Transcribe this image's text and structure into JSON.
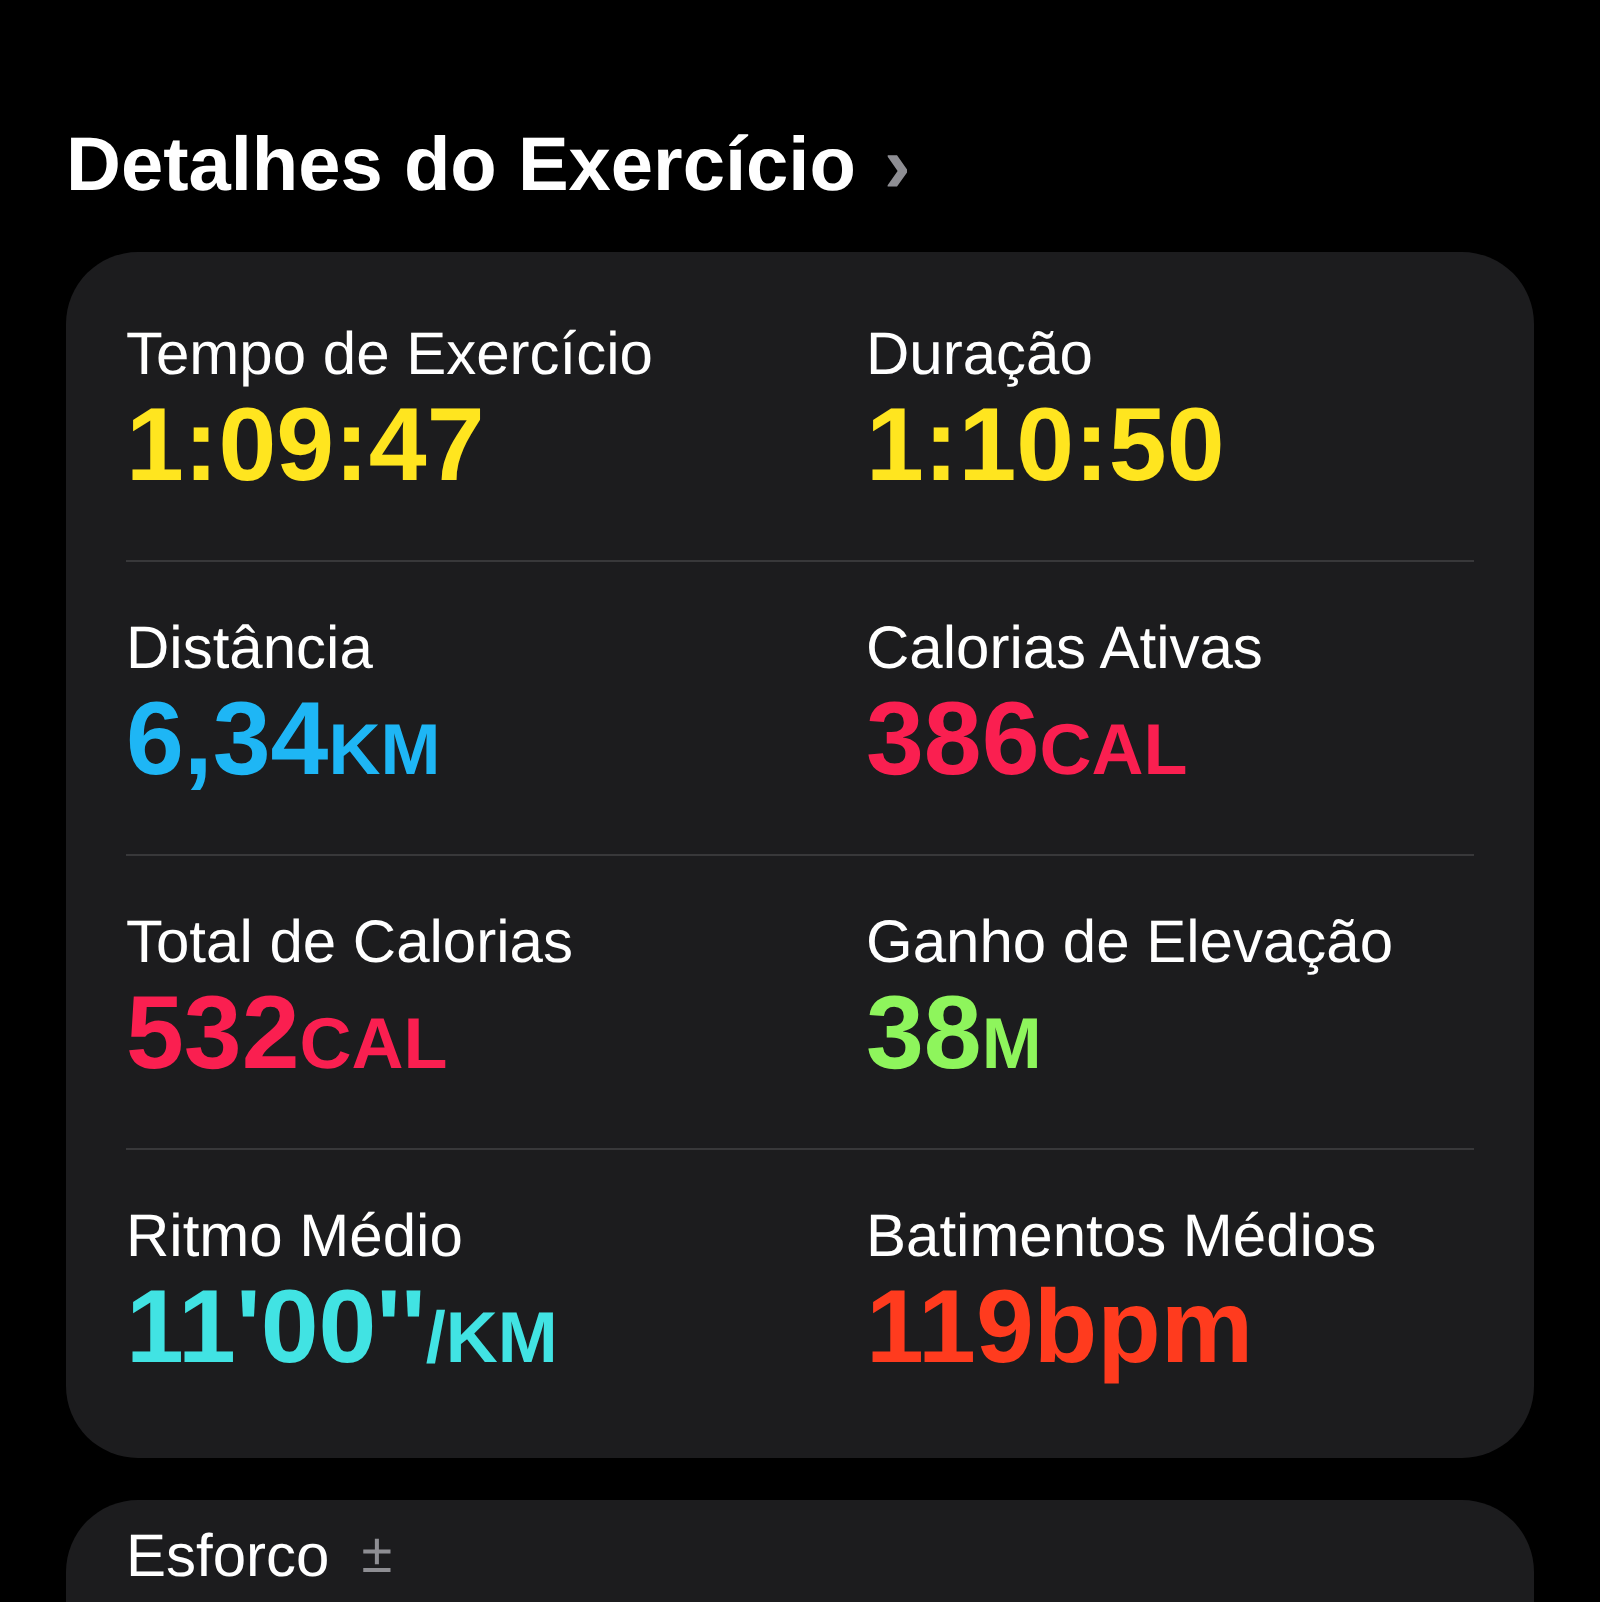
{
  "header": {
    "title": "Detalhes do Exercício",
    "chevron": "›"
  },
  "metrics": [
    {
      "label": "Tempo de Exercício",
      "value": "1:09:47",
      "color": "#ffe51f"
    },
    {
      "label": "Duração",
      "value": "1:10:50",
      "color": "#ffe51f"
    },
    {
      "label": "Distância",
      "value": "6,34",
      "unit": "KM",
      "color": "#1eb6f5"
    },
    {
      "label": "Calorias Ativas",
      "value": "386",
      "unit": "CAL",
      "color": "#fa1f50"
    },
    {
      "label": "Total de Calorias",
      "value": "532",
      "unit": "CAL",
      "color": "#fa1f50"
    },
    {
      "label": "Ganho de Elevação",
      "value": "38",
      "unit": "M",
      "color": "#8ef55c"
    },
    {
      "label": "Ritmo Médio",
      "value": "11'00''",
      "unit": "/KM",
      "color": "#41e3e3"
    },
    {
      "label": "Batimentos Médios",
      "value": "119bpm",
      "color": "#ff3b1e"
    }
  ],
  "effort": {
    "title": "Esforco",
    "symbol": "±"
  }
}
